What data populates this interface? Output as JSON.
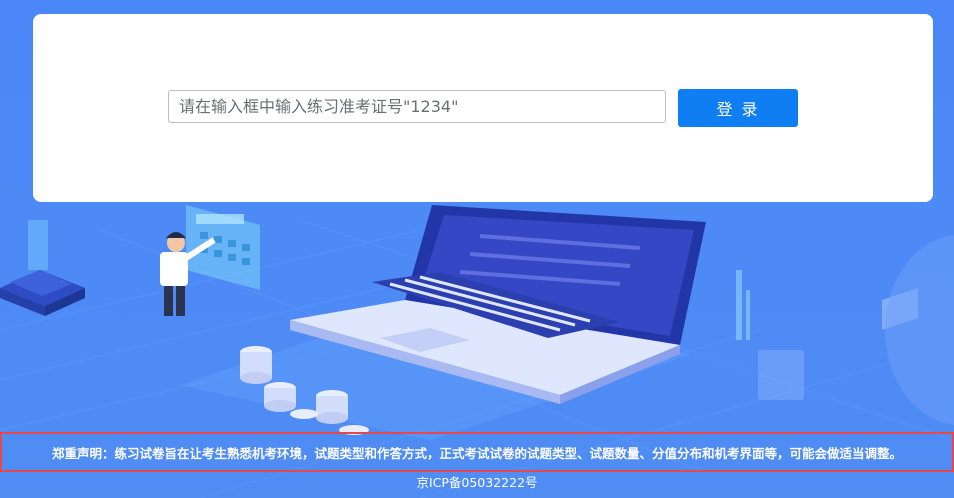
{
  "login": {
    "input_placeholder": "请在输入框中输入练习准考证号\"1234\"",
    "button_label": "登 录"
  },
  "footer": {
    "notice": "郑重声明：练习试卷旨在让考生熟悉机考环境，试题类型和作答方式，正式考试试卷的试题类型、试题数量、分值分布和机考界面等，可能会做适当调整。",
    "icp": "京ICP备05032222号"
  },
  "colors": {
    "background": "#4a86f5",
    "accent": "#0f7ef3",
    "notice_border": "#e8484a"
  },
  "icons": [
    "laptop-illustration",
    "person-illustration",
    "calculator-illustration",
    "coin-stack-illustration",
    "server-illustration"
  ]
}
